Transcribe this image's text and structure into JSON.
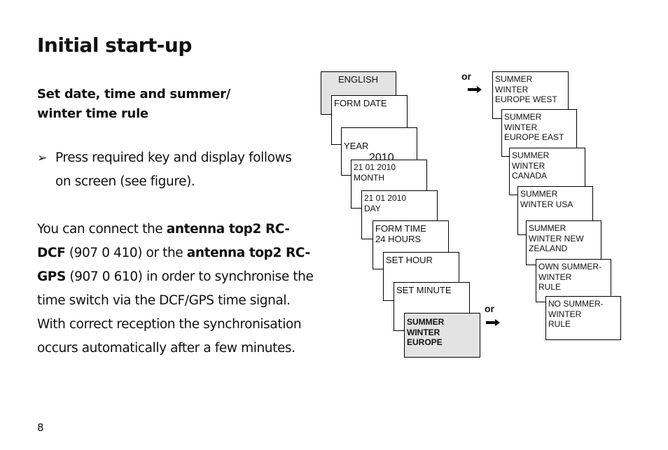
{
  "page": {
    "title": "Initial start-up",
    "subtitle_line1": "Set date, time and summer/",
    "subtitle_line2": "winter time rule",
    "bullet_icon": "arrowhead-bullet-icon",
    "bullet_glyph": "➢",
    "bullet_text": "Press required key and display follows on screen (see figure).",
    "para": {
      "t1": "You can connect the ",
      "b1": "antenna top2 RC-DCF",
      "t2": " (907 0 410) or the ",
      "b2": "antenna top2 RC-GPS",
      "t3": " (907 0 610) in order to synchronise the time switch via the DCF/GPS time signal.",
      "t4": "With correct reception the synchronisation occurs automatically after a few minutes."
    },
    "page_number": "8"
  },
  "figure": {
    "main_sequence": [
      {
        "text": "ENGLISH"
      },
      {
        "text": "FORM DATE"
      },
      {
        "text": "YEAR",
        "value": "2010"
      },
      {
        "text": "21 01 2010\nMONTH"
      },
      {
        "text": "21 01 2010\nDAY"
      },
      {
        "text": "FORM TIME\n24 HOURS"
      },
      {
        "text": "SET HOUR"
      },
      {
        "text": "SET MINUTE"
      },
      {
        "text": "SUMMER\nWINTER\nEUROPE"
      }
    ],
    "alternatives": [
      {
        "text": "SUMMER\nWINTER\nEUROPE WEST"
      },
      {
        "text": "SUMMER\nWINTER\nEUROPE EAST"
      },
      {
        "text": "SUMMER\nWINTER\nCANADA"
      },
      {
        "text": "SUMMER\nWINTER USA"
      },
      {
        "text": "SUMMER\nWINTER NEW\nZEALAND"
      },
      {
        "text": "OWN SUMMER-\nWINTER\nRULE"
      },
      {
        "text": "NO SUMMER-\nWINTER\nRULE"
      }
    ],
    "or_label": "or",
    "arrow_icon": "right-arrow-icon"
  }
}
